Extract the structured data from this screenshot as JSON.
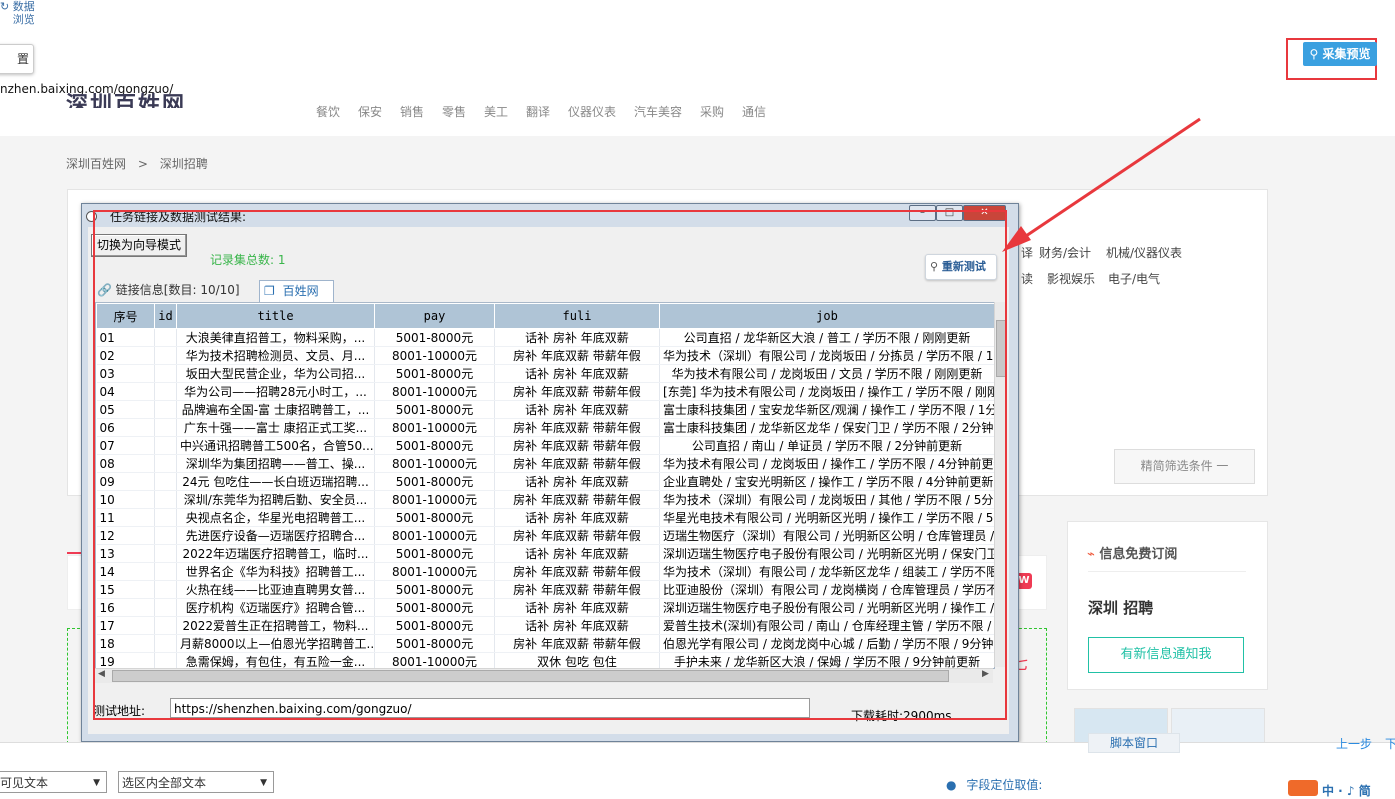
{
  "host": {
    "data_browse_label": "数据\n浏览",
    "left_button_label": "置",
    "url_display": "nzhen.baixing.com/gongzuo/",
    "collect_preview_label": "采集预览"
  },
  "website": {
    "logo_text": "深圳百姓网",
    "nav_items": [
      "餐饮",
      "保安",
      "销售",
      "零售",
      "美工",
      "翻译",
      "仪器仪表",
      "汽车美容",
      "采购",
      "通信"
    ],
    "breadcrumb": [
      "深圳百姓网",
      "深圳招聘"
    ],
    "breadcrumb_sep": ">",
    "categories_row1": [
      "译",
      "财务/会计",
      "机械/仪器仪表"
    ],
    "categories_row2": [
      "读",
      "影视娱乐",
      "电子/电气"
    ],
    "filter_label": "精简筛选条件 一",
    "subscribe_title": "信息免费订阅",
    "city_title": "深圳 招聘",
    "notify_button": "有新信息通知我",
    "app_badge": "W",
    "sidebar_fragment": "七"
  },
  "dialog": {
    "title": "任务链接及数据测试结果:",
    "guide_mode_button": "切换为向导模式",
    "record_total": "记录集总数: 1",
    "retest_button": "重新测试",
    "tab_links": "链接信息[数目: 10/10]",
    "tab_site": "百姓网",
    "columns": [
      "序号",
      "id",
      "title",
      "pay",
      "fuli",
      "job"
    ],
    "rows": [
      [
        "01",
        "",
        "大浪美律直招普工，物料采购，...",
        "5001-8000元",
        "话补 房补 年底双薪",
        "公司直招 / 龙华新区大浪 / 普工 / 学历不限 / 刚刚更新"
      ],
      [
        "02",
        "",
        "华为技术招聘检测员、文员、月...",
        "8001-10000元",
        "房补 年底双薪 带薪年假",
        "华为技术（深圳）有限公司 / 龙岗坂田 / 分拣员 / 学历不限 / 1"
      ],
      [
        "03",
        "",
        "坂田大型民营企业，华为公司招...",
        "5001-8000元",
        "话补 房补 年底双薪",
        "华为技术有限公司 / 龙岗坂田 / 文员 / 学历不限 / 刚刚更新"
      ],
      [
        "04",
        "",
        "华为公司——招聘28元小时工，...",
        "8001-10000元",
        "房补 年底双薪 带薪年假",
        "[东莞] 华为技术有限公司 / 龙岗坂田 / 操作工 / 学历不限 / 刚刚"
      ],
      [
        "05",
        "",
        "品牌遍布全国-富 士康招聘普工，...",
        "5001-8000元",
        "话补 房补 年底双薪",
        "富士康科技集团 / 宝安龙华新区/观澜 / 操作工 / 学历不限 / 1分"
      ],
      [
        "06",
        "",
        "广东十强——富士 康招正式工奖...",
        "8001-10000元",
        "房补 年底双薪 带薪年假",
        "富士康科技集团 / 龙华新区龙华 / 保安门卫 / 学历不限 / 2分钟"
      ],
      [
        "07",
        "",
        "中兴通讯招聘普工500名，合管50...",
        "5001-8000元",
        "房补 年底双薪 带薪年假",
        "公司直招 / 南山 / 单证员 / 学历不限 / 2分钟前更新"
      ],
      [
        "08",
        "",
        "深圳华为集团招聘——普工、操...",
        "8001-10000元",
        "房补 年底双薪 带薪年假",
        "华为技术有限公司 / 龙岗坂田 / 操作工 / 学历不限 / 4分钟前更新"
      ],
      [
        "09",
        "",
        "24元 包吃住——长白班迈瑞招聘...",
        "5001-8000元",
        "话补 房补 年底双薪",
        "企业直聘处 / 宝安光明新区 / 操作工 / 学历不限 / 4分钟前更新"
      ],
      [
        "10",
        "",
        "深圳/东莞华为招聘后勤、安全员...",
        "8001-10000元",
        "房补 年底双薪 带薪年假",
        "华为技术（深圳）有限公司 / 龙岗坂田 / 其他 / 学历不限 / 5分"
      ],
      [
        "11",
        "",
        "央视点名企，华星光电招聘普工...",
        "5001-8000元",
        "话补 房补 年底双薪",
        "华星光电技术有限公司 / 光明新区光明 / 操作工 / 学历不限 / 5分"
      ],
      [
        "12",
        "",
        "先进医疗设备—迈瑞医疗招聘合...",
        "8001-10000元",
        "房补 年底双薪 带薪年假",
        "迈瑞生物医疗（深圳）有限公司 / 光明新区公明 / 仓库管理员 / 学"
      ],
      [
        "13",
        "",
        "2022年迈瑞医疗招聘普工，临时...",
        "5001-8000元",
        "话补 房补 年底双薪",
        "深圳迈瑞生物医疗电子股份有限公司 / 光明新区光明 / 保安门卫 /"
      ],
      [
        "14",
        "",
        "世界名企《华为科技》招聘普工...",
        "8001-10000元",
        "房补 年底双薪 带薪年假",
        "华为技术（深圳）有限公司 / 龙华新区龙华 / 组装工 / 学历不限 /"
      ],
      [
        "15",
        "",
        "火热在线——比亚迪直聘男女普...",
        "5001-8000元",
        "房补 年底双薪 带薪年假",
        "比亚迪股份（深圳）有限公司 / 龙岗横岗 / 仓库管理员 / 学历不限"
      ],
      [
        "16",
        "",
        "医疗机构《迈瑞医疗》招聘合管...",
        "5001-8000元",
        "话补 房补 年底双薪",
        "深圳迈瑞生物医疗电子股份有限公司 / 光明新区光明 / 操作工 / 学"
      ],
      [
        "17",
        "",
        "2022爱普生正在招聘普工，物料...",
        "5001-8000元",
        "话补 房补 年底双薪",
        "爱普生技术(深圳)有限公司 / 南山 / 仓库经理主管 / 学历不限 / 9"
      ],
      [
        "18",
        "",
        "月薪8000以上—伯恩光学招聘普工...",
        "5001-8000元",
        "房补 年底双薪 带薪年假",
        "伯恩光学有限公司 / 龙岗龙岗中心城 / 后勤 / 学历不限 / 9分钟"
      ],
      [
        "19",
        "",
        "急需保姆，有包住，有五险一金...",
        "8001-10000元",
        "双休 包吃 包住",
        "手护未来 / 龙华新区大浪 / 保姆 / 学历不限 / 9分钟前更新"
      ]
    ],
    "address_label": "测试地址:",
    "address_value": "https://shenzhen.baixing.com/gongzuo/",
    "download_time": "下载耗时:2900ms"
  },
  "bottom": {
    "script_window": "脚本窗口",
    "prev_step": "上一步",
    "next_step": "下",
    "select1": "可见文本",
    "select2": "选区内全部文本",
    "field_locate": "字段定位取值:",
    "brand_text": "中 · ♪ 简"
  },
  "colors": {
    "annotation_red": "#e8383d",
    "accent_blue": "#3aa0e0",
    "record_green": "#39b54a",
    "teal": "#21c1a6",
    "header_blue": "#afc4d6"
  }
}
